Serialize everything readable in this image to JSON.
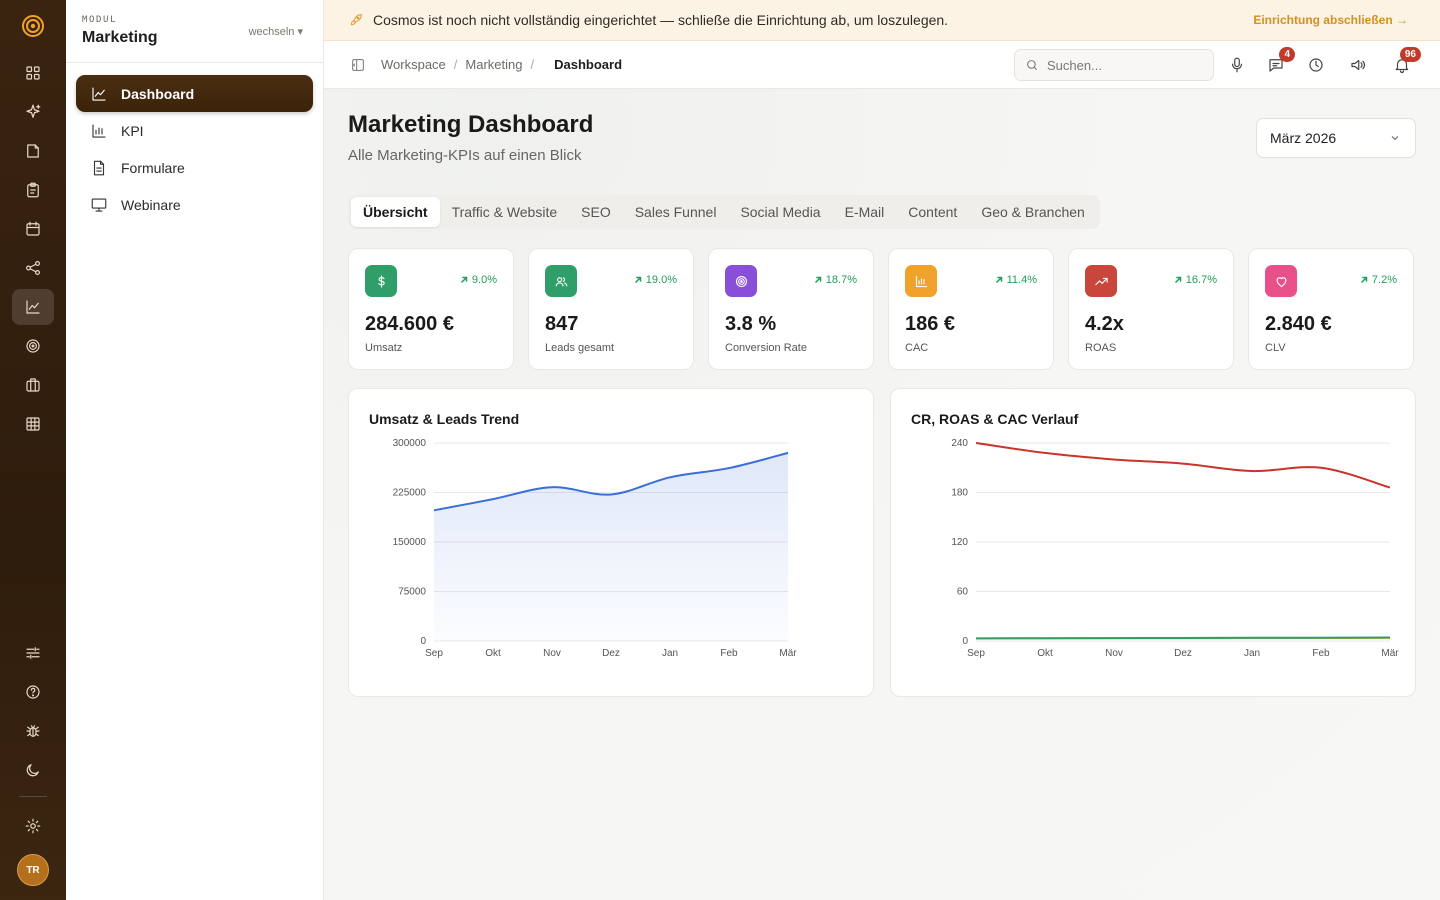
{
  "banner": {
    "text": "Cosmos ist noch nicht vollständig eingerichtet — schließe die Einrichtung ab, um loszulegen.",
    "link": "Einrichtung abschließen →"
  },
  "module": {
    "label": "MODUL",
    "name": "Marketing",
    "switch_label": "wechseln ▾"
  },
  "nav": [
    {
      "label": "Dashboard",
      "icon": "line-chart-icon",
      "active": true
    },
    {
      "label": "KPI",
      "icon": "bar-chart-icon",
      "active": false
    },
    {
      "label": "Formulare",
      "icon": "document-icon",
      "active": false
    },
    {
      "label": "Webinare",
      "icon": "presentation-icon",
      "active": false
    }
  ],
  "rail": {
    "avatar_initials": "TR"
  },
  "breadcrumb": {
    "items": [
      "Workspace",
      "Marketing"
    ],
    "current": "Dashboard"
  },
  "search": {
    "placeholder": "Suchen..."
  },
  "notifications": {
    "messages_count": "4",
    "bell_count": "96"
  },
  "page": {
    "title": "Marketing Dashboard",
    "subtitle": "Alle Marketing-KPIs auf einen Blick",
    "month": "März 2026"
  },
  "tabs": [
    "Übersicht",
    "Traffic & Website",
    "SEO",
    "Sales Funnel",
    "Social Media",
    "E-Mail",
    "Content",
    "Geo & Branchen"
  ],
  "kpis": [
    {
      "value": "284.600 €",
      "label": "Umsatz",
      "change": "9.0%",
      "color": "#2f9e68",
      "icon": "dollar-icon"
    },
    {
      "value": "847",
      "label": "Leads gesamt",
      "change": "19.0%",
      "color": "#2f9e68",
      "icon": "users-icon"
    },
    {
      "value": "3.8 %",
      "label": "Conversion Rate",
      "change": "18.7%",
      "color": "#8a4fd8",
      "icon": "target-icon"
    },
    {
      "value": "186 €",
      "label": "CAC",
      "change": "11.4%",
      "color": "#f0a22a",
      "icon": "bar-chart-icon"
    },
    {
      "value": "4.2x",
      "label": "ROAS",
      "change": "16.7%",
      "color": "#c8473a",
      "icon": "trending-up-icon"
    },
    {
      "value": "2.840 €",
      "label": "CLV",
      "change": "7.2%",
      "color": "#e8508a",
      "icon": "heart-icon"
    }
  ],
  "chart_data": [
    {
      "type": "area",
      "title": "Umsatz & Leads Trend",
      "categories": [
        "Sep",
        "Okt",
        "Nov",
        "Dez",
        "Jan",
        "Feb",
        "Mär"
      ],
      "ylim": [
        0,
        300000
      ],
      "yticks": [
        "0",
        "75000",
        "150000",
        "225000",
        "300000"
      ],
      "series": [
        {
          "values": [
            198000,
            215000,
            233000,
            222000,
            248000,
            262000,
            285000
          ],
          "color": "#3a6fd8"
        }
      ]
    },
    {
      "type": "line",
      "title": "CR, ROAS & CAC Verlauf",
      "categories": [
        "Sep",
        "Okt",
        "Nov",
        "Dez",
        "Jan",
        "Feb",
        "Mär"
      ],
      "ylim": [
        0,
        240
      ],
      "yticks": [
        "0",
        "60",
        "120",
        "180",
        "240"
      ],
      "series": [
        {
          "values": [
            240,
            228,
            220,
            215,
            206,
            210,
            186
          ],
          "color": "#c8332a"
        },
        {
          "values": [
            3.1,
            3.2,
            3.3,
            3.4,
            3.5,
            3.6,
            3.8
          ],
          "color": "#f0a22a"
        },
        {
          "values": [
            3.2,
            3.4,
            3.5,
            3.7,
            3.9,
            4.0,
            4.2
          ],
          "color": "#2f9e68"
        }
      ]
    }
  ]
}
